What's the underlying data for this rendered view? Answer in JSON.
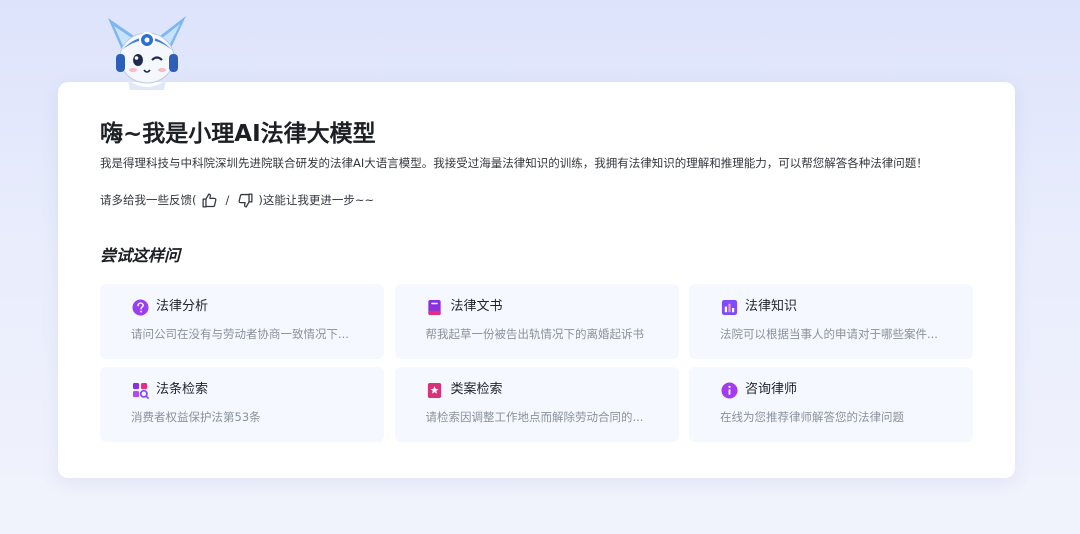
{
  "header": {
    "title": "嗨~我是小理AI法律大模型",
    "intro": "我是得理科技与中科院深圳先进院联合研发的法律AI大语言模型。我接受过海量法律知识的训练，我拥有法律知识的理解和推理能力，可以帮您解答各种法律问题！",
    "feedback_prefix": "请多给我一些反馈(",
    "feedback_sep": "/",
    "feedback_suffix": ")这能让我更进一步~~"
  },
  "suggestions": {
    "heading": "尝试这样问",
    "items": [
      {
        "title": "法律分析",
        "desc": "请问公司在没有与劳动者协商一致情况下...",
        "icon": "question-circle-icon",
        "color": "#9b3df2"
      },
      {
        "title": "法律文书",
        "desc": "帮我起草一份被告出轨情况下的离婚起诉书",
        "icon": "book-icon",
        "color": "#8b2fe0"
      },
      {
        "title": "法律知识",
        "desc": "法院可以根据当事人的申请对于哪些案件...",
        "icon": "bar-chart-icon",
        "color": "#7c4dff"
      },
      {
        "title": "法条检索",
        "desc": "消费者权益保护法第53条",
        "icon": "search-grid-icon",
        "color": "#b24cf0"
      },
      {
        "title": "类案检索",
        "desc": "请检索因调整工作地点而解除劳动合同的...",
        "icon": "star-bookmark-icon",
        "color": "#d6337a"
      },
      {
        "title": "咨询律师",
        "desc": "在线为您推荐律师解答您的法律问题",
        "icon": "info-circle-icon",
        "color": "#a33cf0"
      }
    ]
  }
}
